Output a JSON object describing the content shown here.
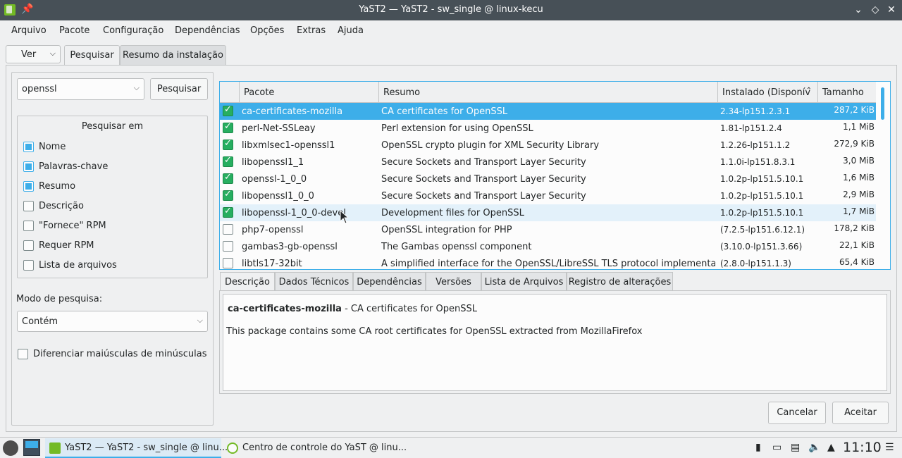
{
  "window": {
    "title": "YaST2 — YaST2 - sw_single @ linux-kecu"
  },
  "menubar": {
    "items": [
      "Arquivo",
      "Pacote",
      "Configuração",
      "Dependências",
      "Opções",
      "Extras",
      "Ajuda"
    ]
  },
  "toolbar": {
    "view_label": "Ver",
    "tabs": [
      "Pesquisar",
      "Resumo da instalação"
    ]
  },
  "search": {
    "query": "openssl",
    "button_label": "Pesquisar",
    "group_title": "Pesquisar em",
    "options": [
      {
        "label": "Nome",
        "checked": true
      },
      {
        "label": "Palavras-chave",
        "checked": true
      },
      {
        "label": "Resumo",
        "checked": true
      },
      {
        "label": "Descrição",
        "checked": false
      },
      {
        "label": "\"Fornece\" RPM",
        "checked": false
      },
      {
        "label": "Requer RPM",
        "checked": false
      },
      {
        "label": "Lista de arquivos",
        "checked": false
      }
    ],
    "mode_label": "Modo de pesquisa:",
    "mode_value": "Contém",
    "case_label": "Diferenciar maiúsculas de minúsculas",
    "case_checked": false
  },
  "packages": {
    "columns": [
      "Pacote",
      "Resumo",
      "Instalado (Disponív",
      "Tamanho"
    ],
    "rows": [
      {
        "installed": true,
        "name": "ca-certificates-mozilla",
        "summary": "CA certificates for OpenSSL",
        "version": "2.34-lp151.2.3.1",
        "size": "287,2 KiB"
      },
      {
        "installed": true,
        "name": "perl-Net-SSLeay",
        "summary": "Perl extension for using OpenSSL",
        "version": "1.81-lp151.2.4",
        "size": "1,1 MiB"
      },
      {
        "installed": true,
        "name": "libxmlsec1-openssl1",
        "summary": "OpenSSL crypto plugin for XML Security Library",
        "version": "1.2.26-lp151.1.2",
        "size": "272,9 KiB"
      },
      {
        "installed": true,
        "name": "libopenssl1_1",
        "summary": "Secure Sockets and Transport Layer Security",
        "version": "1.1.0i-lp151.8.3.1",
        "size": "3,0 MiB"
      },
      {
        "installed": true,
        "name": "openssl-1_0_0",
        "summary": "Secure Sockets and Transport Layer Security",
        "version": "1.0.2p-lp151.5.10.1",
        "size": "1,6 MiB"
      },
      {
        "installed": true,
        "name": "libopenssl1_0_0",
        "summary": "Secure Sockets and Transport Layer Security",
        "version": "1.0.2p-lp151.5.10.1",
        "size": "2,9 MiB"
      },
      {
        "installed": true,
        "name": "libopenssl-1_0_0-devel",
        "summary": "Development files for OpenSSL",
        "version": "1.0.2p-lp151.5.10.1",
        "size": "1,7 MiB"
      },
      {
        "installed": false,
        "name": "php7-openssl",
        "summary": "OpenSSL integration for PHP",
        "version": "(7.2.5-lp151.6.12.1)",
        "size": "178,2 KiB"
      },
      {
        "installed": false,
        "name": "gambas3-gb-openssl",
        "summary": "The Gambas openssl component",
        "version": "(3.10.0-lp151.3.66)",
        "size": "22,1 KiB"
      },
      {
        "installed": false,
        "name": "libtls17-32bit",
        "summary": "A simplified interface for the OpenSSL/LibreSSL TLS protocol implementation",
        "version": "(2.8.0-lp151.1.3)",
        "size": "65,4 KiB"
      }
    ]
  },
  "details": {
    "tabs": [
      "Descrição",
      "Dados Técnicos",
      "Dependências",
      "Versões",
      "Lista de Arquivos",
      "Registro de alterações"
    ],
    "package_name": "ca-certificates-mozilla",
    "package_summary": " - CA certificates for OpenSSL",
    "description": "This package contains some CA root certificates for OpenSSL extracted from MozillaFirefox"
  },
  "actions": {
    "cancel": "Cancelar",
    "accept": "Aceitar"
  },
  "taskbar": {
    "items": [
      "YaST2 — YaST2 - sw_single @ linu...",
      "Centro de controle do YaST @ linu..."
    ],
    "clock": "11:10"
  }
}
